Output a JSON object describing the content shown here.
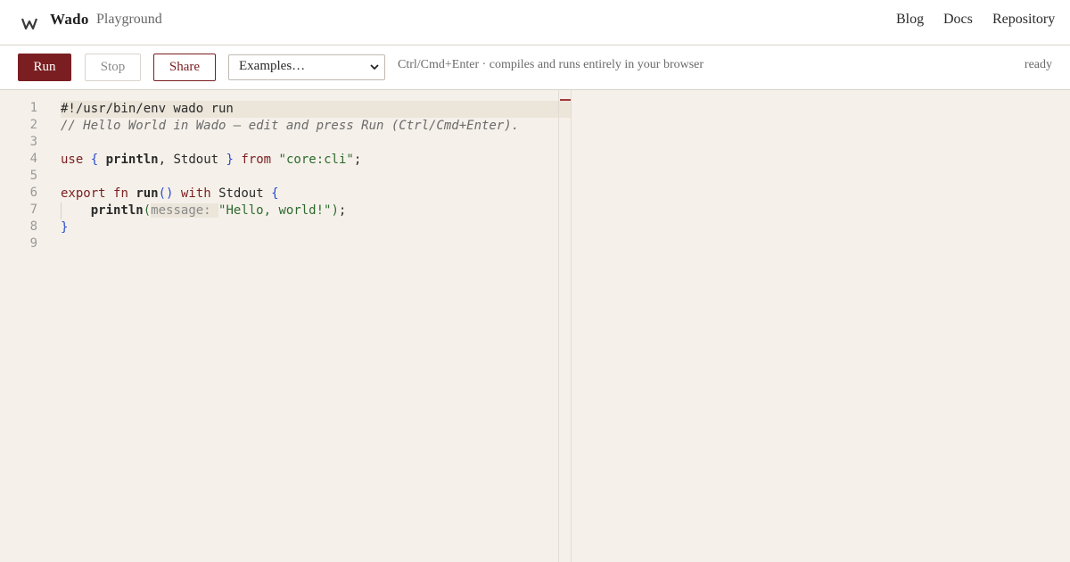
{
  "header": {
    "brand": "Wado",
    "subtitle": "Playground",
    "logo_icon": "wado-logo-icon",
    "nav": [
      {
        "label": "Blog"
      },
      {
        "label": "Docs"
      },
      {
        "label": "Repository"
      }
    ]
  },
  "toolbar": {
    "run_label": "Run",
    "stop_label": "Stop",
    "share_label": "Share",
    "examples_selected": "Examples…",
    "hint": "Ctrl/Cmd+Enter · compiles and runs entirely in your browser",
    "status": "ready"
  },
  "editor": {
    "line_numbers": [
      "1",
      "2",
      "3",
      "4",
      "5",
      "6",
      "7",
      "8",
      "9"
    ],
    "tokens": {
      "shebang": "#!/usr/bin/env wado run",
      "comment": "// Hello World in Wado — edit and press Run (Ctrl/Cmd+Enter).",
      "use": "use",
      "lbrace": "{",
      "println": "println",
      "comma": ",",
      "stdout": "Stdout",
      "rbrace": "}",
      "from": "from",
      "module": "\"core:cli\"",
      "semi": ";",
      "export": "export",
      "fn": "fn",
      "run": "run",
      "parens": "()",
      "with": "with",
      "lparen": "(",
      "param_hint": "message: ",
      "hello": "\"Hello, world!\"",
      "rparen": ")"
    }
  },
  "colors": {
    "accent": "#7a1e21",
    "background": "#f5f1ea",
    "keyword": "#7a1e21",
    "bracket": "#2a4bd0",
    "string": "#2e6a2e"
  }
}
